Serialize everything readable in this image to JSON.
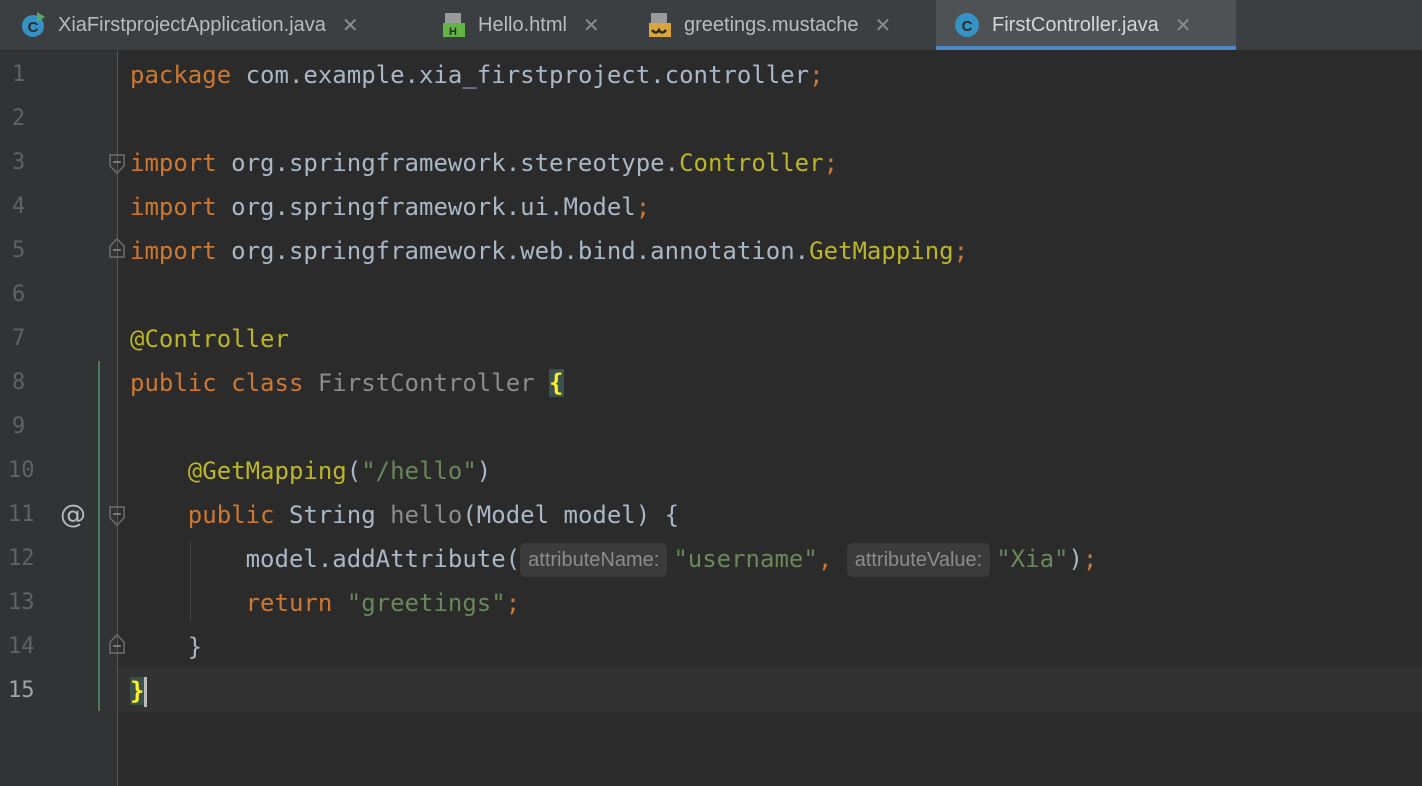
{
  "tabs": [
    {
      "label": "XiaFirstprojectApplication.java",
      "icon": "java-class-run-icon",
      "active": false
    },
    {
      "label": "Hello.html",
      "icon": "html-file-icon",
      "active": false
    },
    {
      "label": "greetings.mustache",
      "icon": "mustache-file-icon",
      "active": false
    },
    {
      "label": "FirstController.java",
      "icon": "java-class-icon",
      "active": true
    }
  ],
  "close_glyph": "✕",
  "gutter": {
    "line_numbers": [
      "1",
      "2",
      "3",
      "4",
      "5",
      "6",
      "7",
      "8",
      "9",
      "10",
      "11",
      "12",
      "13",
      "14",
      "15"
    ],
    "current_line": "15",
    "marker_line_11": "@"
  },
  "code": {
    "l1": {
      "kw": "package",
      "rest": " com.example.xia_firstproject.controller",
      "semi": ";"
    },
    "l3": {
      "kw": "import",
      "rest": " org.springframework.stereotype.",
      "cls": "Controller",
      "semi": ";"
    },
    "l4": {
      "kw": "import",
      "rest": " org.springframework.ui.Model",
      "semi": ";"
    },
    "l5": {
      "kw": "import",
      "rest": " org.springframework.web.bind.annotation.",
      "cls": "GetMapping",
      "semi": ";"
    },
    "l7": {
      "ann": "@Controller"
    },
    "l8": {
      "kw1": "public",
      "kw2": " class",
      "name": " FirstController ",
      "brace": "{"
    },
    "l10": {
      "indent": "    ",
      "ann": "@GetMapping",
      "open": "(",
      "str": "\"/hello\"",
      "close": ")"
    },
    "l11": {
      "indent": "    ",
      "kw": "public",
      "type": " String ",
      "method": "hello",
      "params": "(Model model) {"
    },
    "l12": {
      "indent": "        ",
      "call": "model.addAttribute(",
      "hint1": "attributeName:",
      "str1": "\"username\"",
      "comma": ", ",
      "hint2": "attributeValue:",
      "str2": "\"Xia\"",
      "end": ")",
      "semi": ";"
    },
    "l13": {
      "indent": "        ",
      "kw": "return",
      "str": " \"greetings\"",
      "semi": ";"
    },
    "l14": {
      "indent": "    ",
      "brace": "}"
    },
    "l15": {
      "brace": "}"
    }
  },
  "colors": {
    "background": "#2b2b2b",
    "keyword": "#cc7832",
    "annotation": "#bbb529",
    "string": "#6a8759",
    "text": "#a9b7c6",
    "tab_accent": "#4a88c7"
  }
}
